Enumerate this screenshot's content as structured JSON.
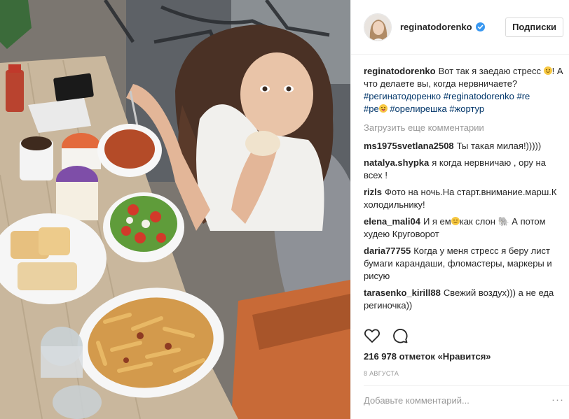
{
  "post": {
    "username": "reginatodorenko",
    "verified": true,
    "follow_label": "Подписки",
    "caption": {
      "user": "reginatodorenko",
      "text_before_emoji": "Вот так я заедаю стресс",
      "text_after_emoji": "! А что делаете вы, когда нервничаете?",
      "hashtags_line1": "#регинатодоренко #reginatodorenko #re",
      "hashtags_line2_pre": "#ре",
      "hashtags_line2_post": " #орелирешка #жортур"
    },
    "load_more_label": "Загрузить еще комментарии",
    "comments": [
      {
        "user": "ms1975svetlana2508",
        "text": "Ты такая милая!)))))"
      },
      {
        "user": "natalya.shypka",
        "text": "я когда нервничаю , ору на всех !"
      },
      {
        "user": "rizls",
        "text": "Фото на ночь.На старт.внимание.марш.К холодильнику!"
      },
      {
        "user": "elena_mali04",
        "text_before_emoji": "И я ем",
        "text_after_emoji": "как слон 🐘 А потом худею Круговорот"
      },
      {
        "user": "daria77755",
        "text": "Когда у меня стресс я беру лист бумаги карандаши, фломастеры, маркеры и рисую"
      },
      {
        "user": "tarasenko_kirill88",
        "text": "Свежий воздух))) а не еда региночка))"
      }
    ],
    "icons": {
      "like": "heart-icon",
      "comment": "comment-bubble-icon",
      "verified": "verified-badge-icon",
      "more": "more-options-icon"
    },
    "likes_text": "216 978 отметок «Нравится»",
    "date": "8 августа",
    "add_comment_placeholder": "Добавьте комментарий...",
    "more_glyph": "···",
    "colors": {
      "link": "#003569",
      "verified": "#3897f0",
      "muted": "#999999",
      "text": "#262626"
    }
  }
}
